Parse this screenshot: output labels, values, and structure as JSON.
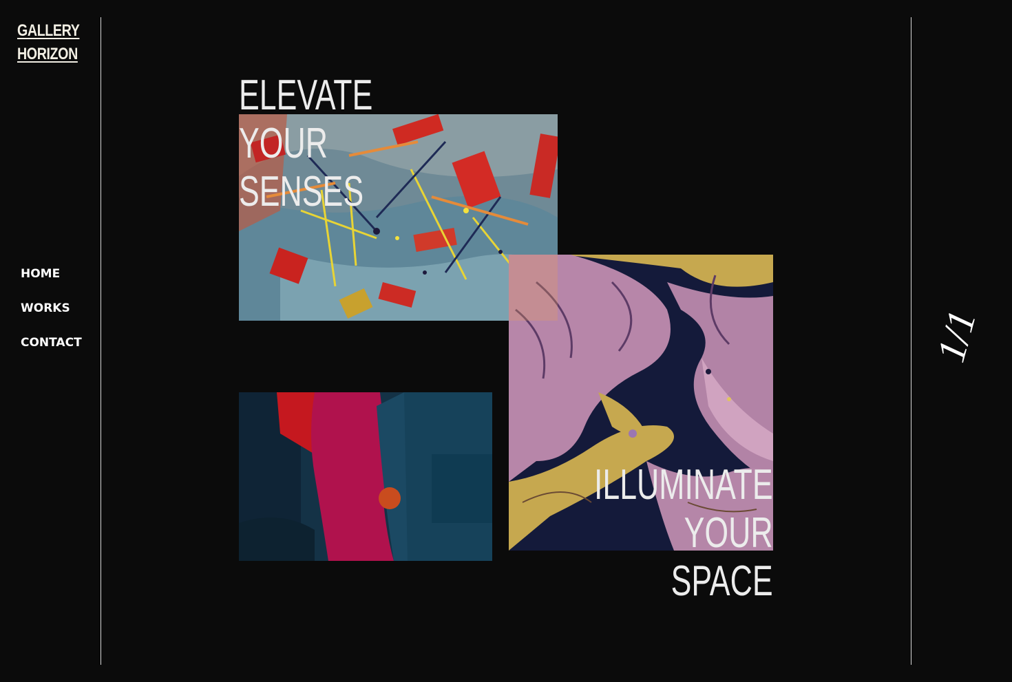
{
  "brand": {
    "line1": "GALLERY",
    "line2": "HORIZON"
  },
  "nav": {
    "items": [
      {
        "label": "HOME"
      },
      {
        "label": "WORKS"
      },
      {
        "label": "CONTACT"
      }
    ]
  },
  "hero": {
    "headline_top": [
      "ELEVATE",
      "YOUR",
      "SENSES"
    ],
    "headline_bottom": [
      "ILLUMINATE",
      "YOUR",
      "SPACE"
    ]
  },
  "pager": {
    "text": "1/1"
  },
  "colors": {
    "background": "#0b0b0b",
    "text": "#ececec",
    "logo": "#f2efe4",
    "divider": "#d9d9d9"
  }
}
